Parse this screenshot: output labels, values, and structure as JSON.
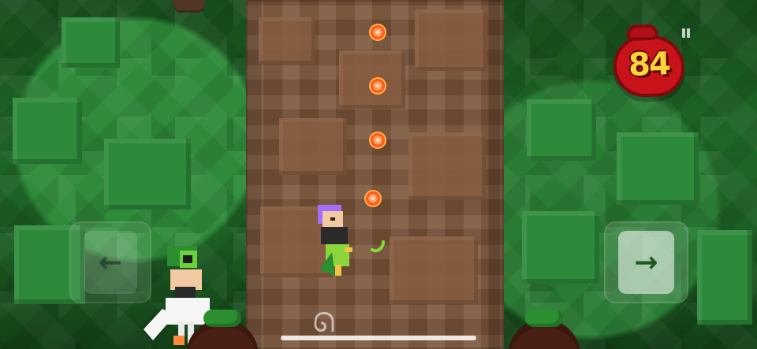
{
  "hud": {
    "fruit_count": "84",
    "pause_icon": "pause-icon",
    "accent": "#c8131b",
    "count_color": "#ffd43a"
  },
  "controls": {
    "left_icon": "arrow-left-icon",
    "left_label": "←",
    "right_icon": "arrow-right-icon",
    "right_label": "→"
  },
  "collectibles": {
    "type": "orange-slice",
    "visible_count": 4,
    "fruit_icon": "orange-slice-icon"
  },
  "characters": {
    "player": "player-character",
    "npc": "npc-rider"
  }
}
